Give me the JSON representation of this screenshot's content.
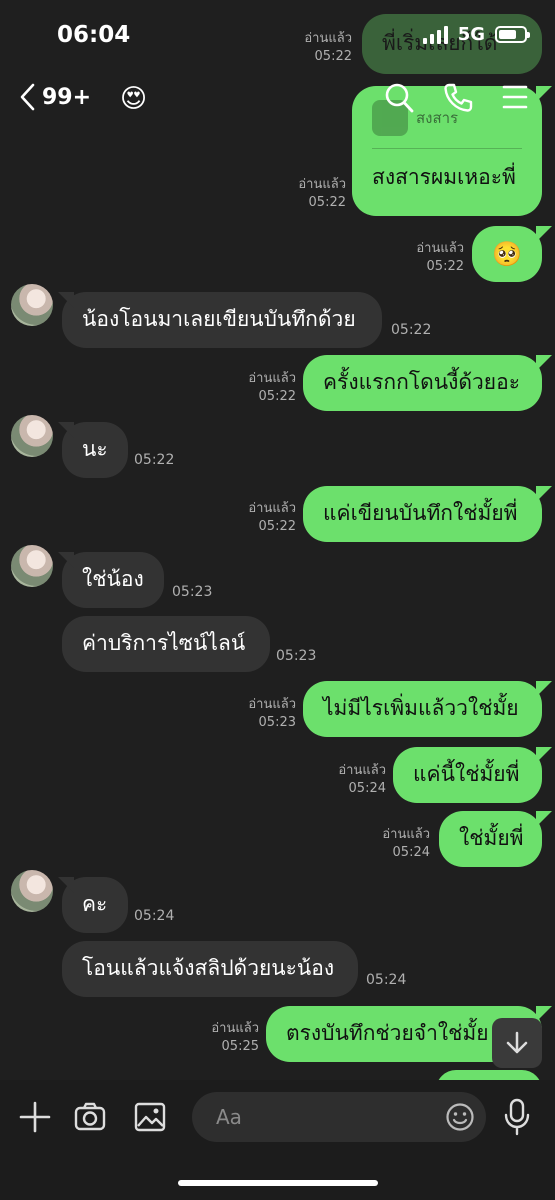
{
  "status_bar": {
    "time": "06:04",
    "network": "5G"
  },
  "header": {
    "unread_count": "99+",
    "contact_emoji": "😍"
  },
  "messages": {
    "pinned_text": "พี่เริ่มเลยก็ได้",
    "pinned_read": "อ่านแล้ว",
    "pinned_time": "05:22",
    "sticker_caption": "สงสาร",
    "m1": {
      "text": "สงสารผมเหอะพี่",
      "read": "อ่านแล้ว",
      "time": "05:22"
    },
    "m2": {
      "text": "🥺",
      "read": "อ่านแล้ว",
      "time": "05:22"
    },
    "m3": {
      "text": "น้องโอนมาเลยเขียนบันทึกด้วย",
      "time": "05:22"
    },
    "m4": {
      "text": "ครั้งแรกกโดนงี้ด้วยอะ",
      "read": "อ่านแล้ว",
      "time": "05:22"
    },
    "m5": {
      "text": "นะ",
      "time": "05:22"
    },
    "m6": {
      "text": "แค่เขียนบันทึกใช่มั้ยพี่",
      "read": "อ่านแล้ว",
      "time": "05:22"
    },
    "m7": {
      "text": "ใช่น้อง",
      "time": "05:23"
    },
    "m8": {
      "text": "ค่าบริการไซน์ไลน์",
      "time": "05:23"
    },
    "m9": {
      "text": "ไม่มีไรเพิ่มแล้ววใช่มั้ย",
      "read": "อ่านแล้ว",
      "time": "05:23"
    },
    "m10": {
      "text": "แค่นี้ใช่มั้ยพี่",
      "read": "อ่านแล้ว",
      "time": "05:24"
    },
    "m11": {
      "text": "ใช่มั้ยพี่",
      "read": "อ่านแล้ว",
      "time": "05:24"
    },
    "m12": {
      "text": "คะ",
      "time": "05:24"
    },
    "m13": {
      "text": "โอนแล้วแจ้งสลิปด้วยนะน้อง",
      "time": "05:24"
    },
    "m14": {
      "text": "ตรงบันทึกช่วยจำใช่มั้ย",
      "read": "อ่านแล้ว",
      "time": "05:25"
    }
  },
  "input": {
    "placeholder": "Aa"
  },
  "colors": {
    "outgoing": "#6ce06c",
    "incoming": "#333333",
    "background": "#1f1f1f"
  }
}
